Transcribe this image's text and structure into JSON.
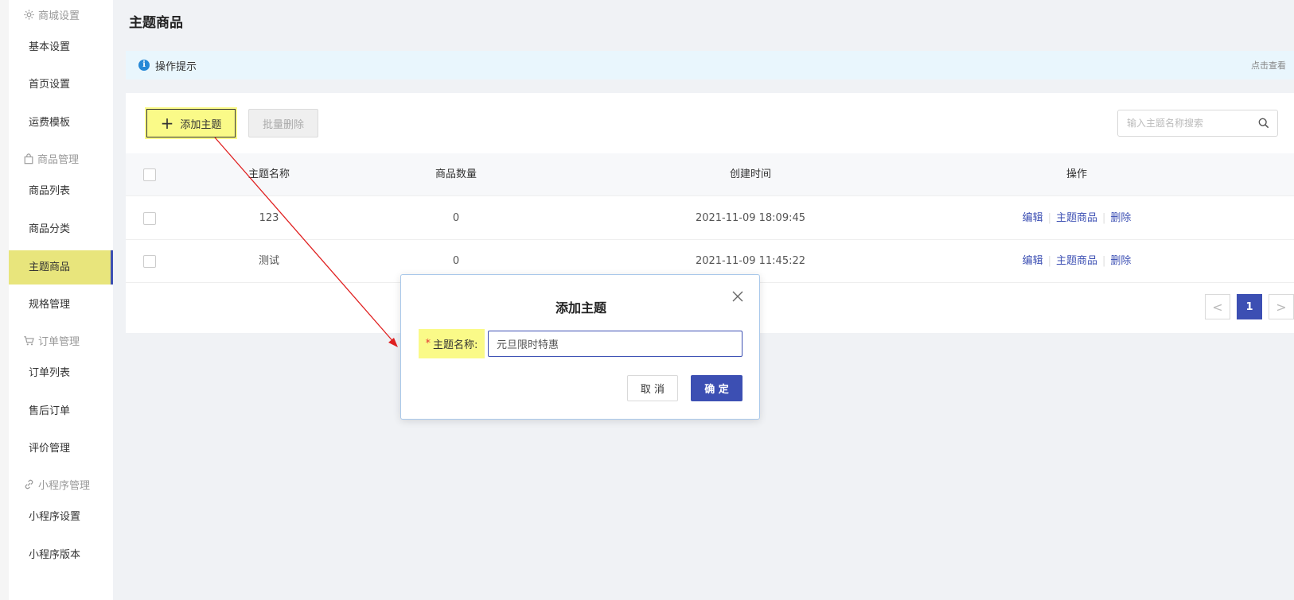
{
  "sidebar": {
    "groups": [
      {
        "label": "商城设置",
        "icon": "gear-icon",
        "items": [
          "基本设置",
          "首页设置",
          "运费模板"
        ]
      },
      {
        "label": "商品管理",
        "icon": "bag-icon",
        "items": [
          "商品列表",
          "商品分类",
          "主题商品",
          "规格管理"
        ]
      },
      {
        "label": "订单管理",
        "icon": "cart-icon",
        "items": [
          "订单列表",
          "售后订单",
          "评价管理"
        ]
      },
      {
        "label": "小程序管理",
        "icon": "link-icon",
        "items": [
          "小程序设置",
          "小程序版本"
        ]
      }
    ],
    "active_item": "主题商品"
  },
  "page": {
    "title": "主题商品"
  },
  "tips": {
    "text": "操作提示",
    "link": "点击查看",
    "icon": "info-icon"
  },
  "toolbar": {
    "add_label": "添加主题",
    "bulk_delete_label": "批量删除",
    "search_placeholder": "输入主题名称搜索"
  },
  "table": {
    "headers": {
      "name": "主题名称",
      "count": "商品数量",
      "time": "创建时间",
      "ops": "操作"
    },
    "rows": [
      {
        "name": "123",
        "count": "0",
        "time": "2021-11-09 18:09:45",
        "ops": [
          "编辑",
          "主题商品",
          "删除"
        ]
      },
      {
        "name": "测试",
        "count": "0",
        "time": "2021-11-09 11:45:22",
        "ops": [
          "编辑",
          "主题商品",
          "删除"
        ]
      }
    ]
  },
  "pagination": {
    "prev": "<",
    "current": "1",
    "next": ">"
  },
  "modal": {
    "title": "添加主题",
    "field_required": "*",
    "field_label": "主题名称:",
    "field_value": "元旦限时特惠",
    "cancel_label": "取 消",
    "ok_label": "确 定"
  },
  "colors": {
    "accent": "#3c4fb3",
    "highlight": "#fafa88",
    "tips_bg": "#e9f6fd",
    "annotation": "#e02020"
  }
}
